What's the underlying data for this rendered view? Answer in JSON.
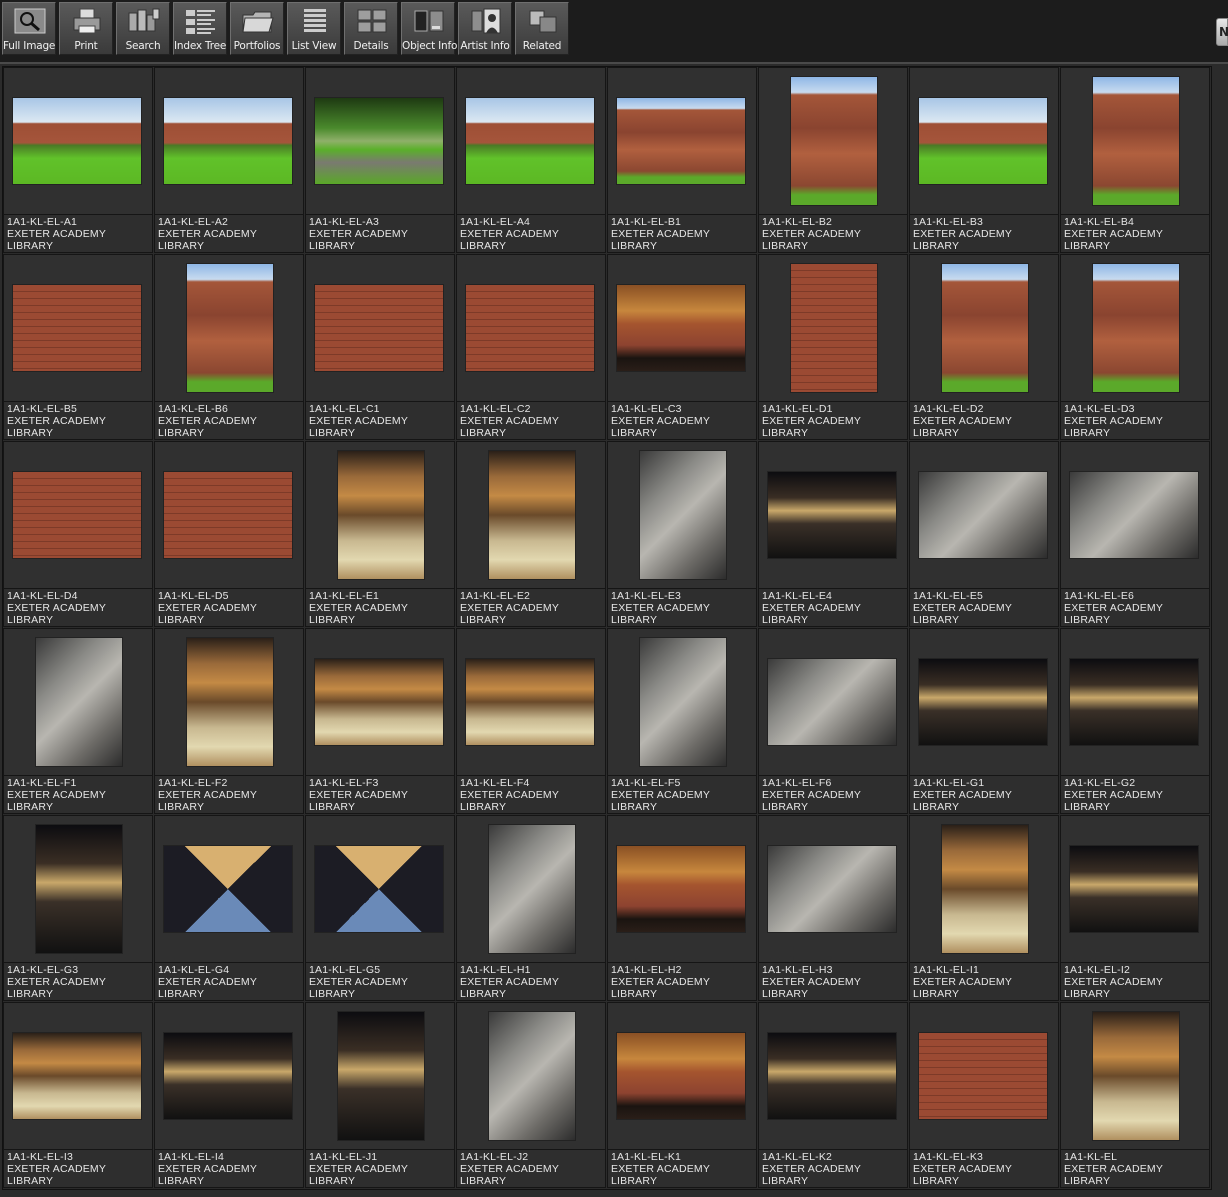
{
  "toolbar": {
    "buttons": [
      {
        "label": "Full Image",
        "icon": "magnifier-icon"
      },
      {
        "label": "Print",
        "icon": "printer-icon"
      },
      {
        "label": "Search",
        "icon": "search-binoculars-icon"
      },
      {
        "label": "Index Tree",
        "icon": "index-tree-icon"
      },
      {
        "label": "Portfolios",
        "icon": "folder-icon"
      },
      {
        "label": "List View",
        "icon": "list-view-icon"
      },
      {
        "label": "Details",
        "icon": "details-grid-icon"
      },
      {
        "label": "Object Info",
        "icon": "object-info-icon"
      },
      {
        "label": "Artist  Info",
        "icon": "artist-portrait-icon"
      },
      {
        "label": "Related",
        "icon": "related-squares-icon"
      }
    ],
    "edge_tab": "N"
  },
  "colors": {
    "toolbar_bg": "#1c1c1c",
    "grid_bg": "#2e2e2e",
    "caption_text": "#e6e6e6"
  },
  "items": [
    {
      "id": "1A1-KL-EL-A1",
      "line2": "EXETER ACADEMY",
      "line3": "LIBRARY",
      "orientation": "landscape",
      "scene": "lawn"
    },
    {
      "id": "1A1-KL-EL-A2",
      "line2": "EXETER ACADEMY",
      "line3": "LIBRARY",
      "orientation": "landscape",
      "scene": "lawn"
    },
    {
      "id": "1A1-KL-EL-A3",
      "line2": "EXETER ACADEMY",
      "line3": "LIBRARY",
      "orientation": "landscape",
      "scene": "path"
    },
    {
      "id": "1A1-KL-EL-A4",
      "line2": "EXETER ACADEMY",
      "line3": "LIBRARY",
      "orientation": "landscape",
      "scene": "lawn"
    },
    {
      "id": "1A1-KL-EL-B1",
      "line2": "EXETER ACADEMY",
      "line3": "LIBRARY",
      "orientation": "landscape",
      "scene": "facade"
    },
    {
      "id": "1A1-KL-EL-B2",
      "line2": "EXETER ACADEMY",
      "line3": "LIBRARY",
      "orientation": "portrait",
      "scene": "facade"
    },
    {
      "id": "1A1-KL-EL-B3",
      "line2": "EXETER ACADEMY",
      "line3": "LIBRARY",
      "orientation": "landscape",
      "scene": "lawn"
    },
    {
      "id": "1A1-KL-EL-B4",
      "line2": "EXETER ACADEMY",
      "line3": "LIBRARY",
      "orientation": "portrait",
      "scene": "facade"
    },
    {
      "id": "1A1-KL-EL-B5",
      "line2": "EXETER ACADEMY",
      "line3": "LIBRARY",
      "orientation": "landscape",
      "scene": "brick"
    },
    {
      "id": "1A1-KL-EL-B6",
      "line2": "EXETER ACADEMY",
      "line3": "LIBRARY",
      "orientation": "portrait",
      "scene": "facade"
    },
    {
      "id": "1A1-KL-EL-C1",
      "line2": "EXETER ACADEMY",
      "line3": "LIBRARY",
      "orientation": "landscape",
      "scene": "brick"
    },
    {
      "id": "1A1-KL-EL-C2",
      "line2": "EXETER ACADEMY",
      "line3": "LIBRARY",
      "orientation": "landscape",
      "scene": "brick"
    },
    {
      "id": "1A1-KL-EL-C3",
      "line2": "EXETER ACADEMY",
      "line3": "LIBRARY",
      "orientation": "landscape",
      "scene": "brickwood"
    },
    {
      "id": "1A1-KL-EL-D1",
      "line2": "EXETER ACADEMY",
      "line3": "LIBRARY",
      "orientation": "portrait",
      "scene": "brick"
    },
    {
      "id": "1A1-KL-EL-D2",
      "line2": "EXETER ACADEMY",
      "line3": "LIBRARY",
      "orientation": "portrait",
      "scene": "facade"
    },
    {
      "id": "1A1-KL-EL-D3",
      "line2": "EXETER ACADEMY",
      "line3": "LIBRARY",
      "orientation": "portrait",
      "scene": "facade"
    },
    {
      "id": "1A1-KL-EL-D4",
      "line2": "EXETER ACADEMY",
      "line3": "LIBRARY",
      "orientation": "landscape",
      "scene": "brick"
    },
    {
      "id": "1A1-KL-EL-D5",
      "line2": "EXETER ACADEMY",
      "line3": "LIBRARY",
      "orientation": "landscape",
      "scene": "brick"
    },
    {
      "id": "1A1-KL-EL-E1",
      "line2": "EXETER ACADEMY",
      "line3": "LIBRARY",
      "orientation": "portrait",
      "scene": "interior"
    },
    {
      "id": "1A1-KL-EL-E2",
      "line2": "EXETER ACADEMY",
      "line3": "LIBRARY",
      "orientation": "portrait",
      "scene": "interior"
    },
    {
      "id": "1A1-KL-EL-E3",
      "line2": "EXETER ACADEMY",
      "line3": "LIBRARY",
      "orientation": "portrait",
      "scene": "concrete"
    },
    {
      "id": "1A1-KL-EL-E4",
      "line2": "EXETER ACADEMY",
      "line3": "LIBRARY",
      "orientation": "landscape",
      "scene": "dark"
    },
    {
      "id": "1A1-KL-EL-E5",
      "line2": "EXETER ACADEMY",
      "line3": "LIBRARY",
      "orientation": "landscape",
      "scene": "concrete"
    },
    {
      "id": "1A1-KL-EL-E6",
      "line2": "EXETER ACADEMY",
      "line3": "LIBRARY",
      "orientation": "landscape",
      "scene": "concrete"
    },
    {
      "id": "1A1-KL-EL-F1",
      "line2": "EXETER ACADEMY",
      "line3": "LIBRARY",
      "orientation": "portrait",
      "scene": "concrete"
    },
    {
      "id": "1A1-KL-EL-F2",
      "line2": "EXETER ACADEMY",
      "line3": "LIBRARY",
      "orientation": "portrait",
      "scene": "interior"
    },
    {
      "id": "1A1-KL-EL-F3",
      "line2": "EXETER ACADEMY",
      "line3": "LIBRARY",
      "orientation": "landscape",
      "scene": "interior"
    },
    {
      "id": "1A1-KL-EL-F4",
      "line2": "EXETER ACADEMY",
      "line3": "LIBRARY",
      "orientation": "landscape",
      "scene": "interior"
    },
    {
      "id": "1A1-KL-EL-F5",
      "line2": "EXETER ACADEMY",
      "line3": "LIBRARY",
      "orientation": "portrait",
      "scene": "concrete"
    },
    {
      "id": "1A1-KL-EL-F6",
      "line2": "EXETER ACADEMY",
      "line3": "LIBRARY",
      "orientation": "landscape",
      "scene": "concrete"
    },
    {
      "id": "1A1-KL-EL-G1",
      "line2": "EXETER ACADEMY",
      "line3": "LIBRARY",
      "orientation": "landscape",
      "scene": "dark"
    },
    {
      "id": "1A1-KL-EL-G2",
      "line2": "EXETER ACADEMY",
      "line3": "LIBRARY",
      "orientation": "landscape",
      "scene": "dark"
    },
    {
      "id": "1A1-KL-EL-G3",
      "line2": "EXETER ACADEMY",
      "line3": "LIBRARY",
      "orientation": "portrait",
      "scene": "dark"
    },
    {
      "id": "1A1-KL-EL-G4",
      "line2": "EXETER ACADEMY",
      "line3": "LIBRARY",
      "orientation": "landscape",
      "scene": "xbeam"
    },
    {
      "id": "1A1-KL-EL-G5",
      "line2": "EXETER ACADEMY",
      "line3": "LIBRARY",
      "orientation": "landscape",
      "scene": "xbeam"
    },
    {
      "id": "1A1-KL-EL-H1",
      "line2": "EXETER ACADEMY",
      "line3": "LIBRARY",
      "orientation": "portrait",
      "scene": "concrete"
    },
    {
      "id": "1A1-KL-EL-H2",
      "line2": "EXETER ACADEMY",
      "line3": "LIBRARY",
      "orientation": "landscape",
      "scene": "brickwood"
    },
    {
      "id": "1A1-KL-EL-H3",
      "line2": "EXETER ACADEMY",
      "line3": "LIBRARY",
      "orientation": "landscape",
      "scene": "concrete"
    },
    {
      "id": "1A1-KL-EL-I1",
      "line2": "EXETER ACADEMY",
      "line3": "LIBRARY",
      "orientation": "portrait",
      "scene": "interior"
    },
    {
      "id": "1A1-KL-EL-I2",
      "line2": "EXETER ACADEMY",
      "line3": "LIBRARY",
      "orientation": "landscape",
      "scene": "dark"
    },
    {
      "id": "1A1-KL-EL-I3",
      "line2": "EXETER ACADEMY",
      "line3": "LIBRARY",
      "orientation": "landscape",
      "scene": "interior"
    },
    {
      "id": "1A1-KL-EL-I4",
      "line2": "EXETER ACADEMY",
      "line3": "LIBRARY",
      "orientation": "landscape",
      "scene": "dark"
    },
    {
      "id": "1A1-KL-EL-J1",
      "line2": "EXETER ACADEMY",
      "line3": "LIBRARY",
      "orientation": "portrait",
      "scene": "dark"
    },
    {
      "id": "1A1-KL-EL-J2",
      "line2": "EXETER ACADEMY",
      "line3": "LIBRARY",
      "orientation": "portrait",
      "scene": "concrete"
    },
    {
      "id": "1A1-KL-EL-K1",
      "line2": "EXETER ACADEMY",
      "line3": "LIBRARY",
      "orientation": "landscape",
      "scene": "brickwood"
    },
    {
      "id": "1A1-KL-EL-K2",
      "line2": "EXETER ACADEMY",
      "line3": "LIBRARY",
      "orientation": "landscape",
      "scene": "dark"
    },
    {
      "id": "1A1-KL-EL-K3",
      "line2": "EXETER ACADEMY",
      "line3": "LIBRARY",
      "orientation": "landscape",
      "scene": "brick"
    },
    {
      "id": "1A1-KL-EL",
      "line2": "EXETER ACADEMY",
      "line3": "LIBRARY",
      "orientation": "portrait",
      "scene": "interior"
    }
  ]
}
